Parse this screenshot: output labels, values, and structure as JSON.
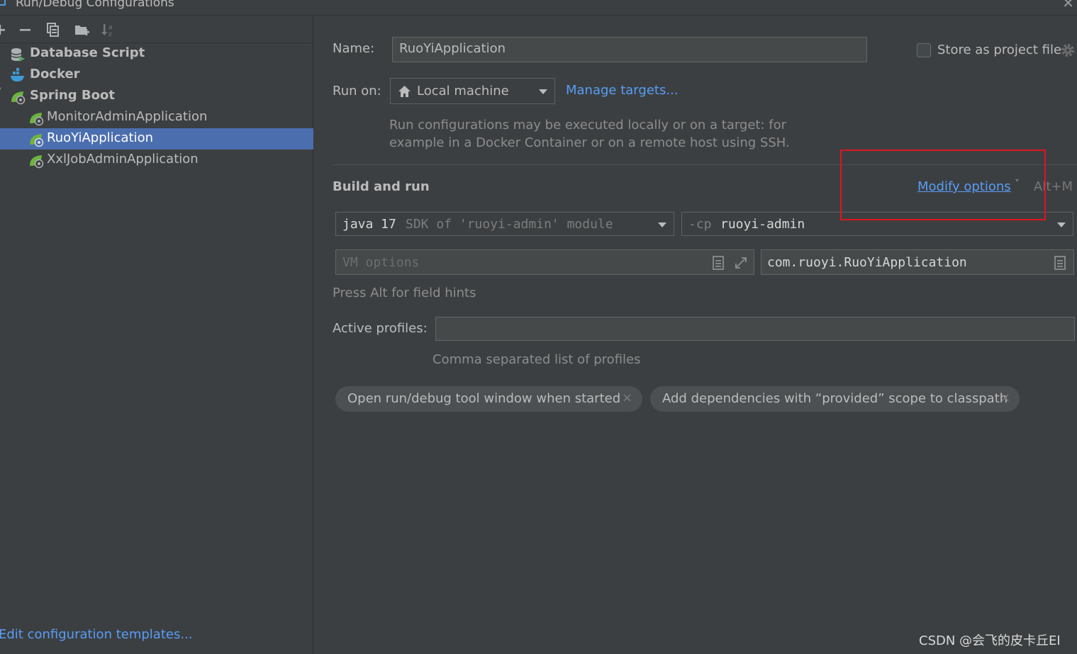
{
  "window": {
    "title": "Run/Debug Configurations"
  },
  "tree": {
    "items": [
      {
        "label": "Database Script",
        "icon": "database-script-icon",
        "bold": true
      },
      {
        "label": "Docker",
        "icon": "docker-icon",
        "bold": true
      },
      {
        "label": "Spring Boot",
        "icon": "spring-boot-icon",
        "bold": true
      },
      {
        "label": "MonitorAdminApplication",
        "icon": "spring-app-icon",
        "bold": false
      },
      {
        "label": "RuoYiApplication",
        "icon": "spring-app-icon",
        "bold": false,
        "selected": true
      },
      {
        "label": "XxlJobAdminApplication",
        "icon": "spring-app-icon",
        "bold": false
      }
    ],
    "edit_templates_link": "Edit configuration templates..."
  },
  "form": {
    "name_label": "Name:",
    "name_value": "RuoYiApplication",
    "store_label": "Store as project file",
    "run_on_label": "Run on:",
    "run_on_value": "Local machine",
    "manage_targets": "Manage targets...",
    "run_on_hint_line1": "Run configurations may be executed locally or on a target: for",
    "run_on_hint_line2": "example in a Docker Container or on a remote host using SSH.",
    "build_and_run_label": "Build and run",
    "modify_options": "Modify options",
    "modify_shortcut": "Alt+M",
    "jdk_main": "java 17",
    "jdk_hint": "SDK of 'ruoyi-admin' module",
    "cp_prefix": "-cp",
    "cp_value": "ruoyi-admin",
    "vm_options_placeholder": "VM options",
    "main_class": "com.ruoyi.RuoYiApplication",
    "alt_hint": "Press Alt for field hints",
    "active_profiles_label": "Active profiles:",
    "active_profiles_value": "",
    "profiles_hint": "Comma separated list of profiles",
    "chips": [
      {
        "label": "Open run/debug tool window when started"
      },
      {
        "label": "Add dependencies with “provided” scope to classpath"
      }
    ]
  },
  "watermark": "CSDN @会飞的皮卡丘EI",
  "colors": {
    "accent_link": "#589df6",
    "selection": "#4b6eaf",
    "highlight_box": "#e0141e",
    "background": "#3c3f41"
  }
}
